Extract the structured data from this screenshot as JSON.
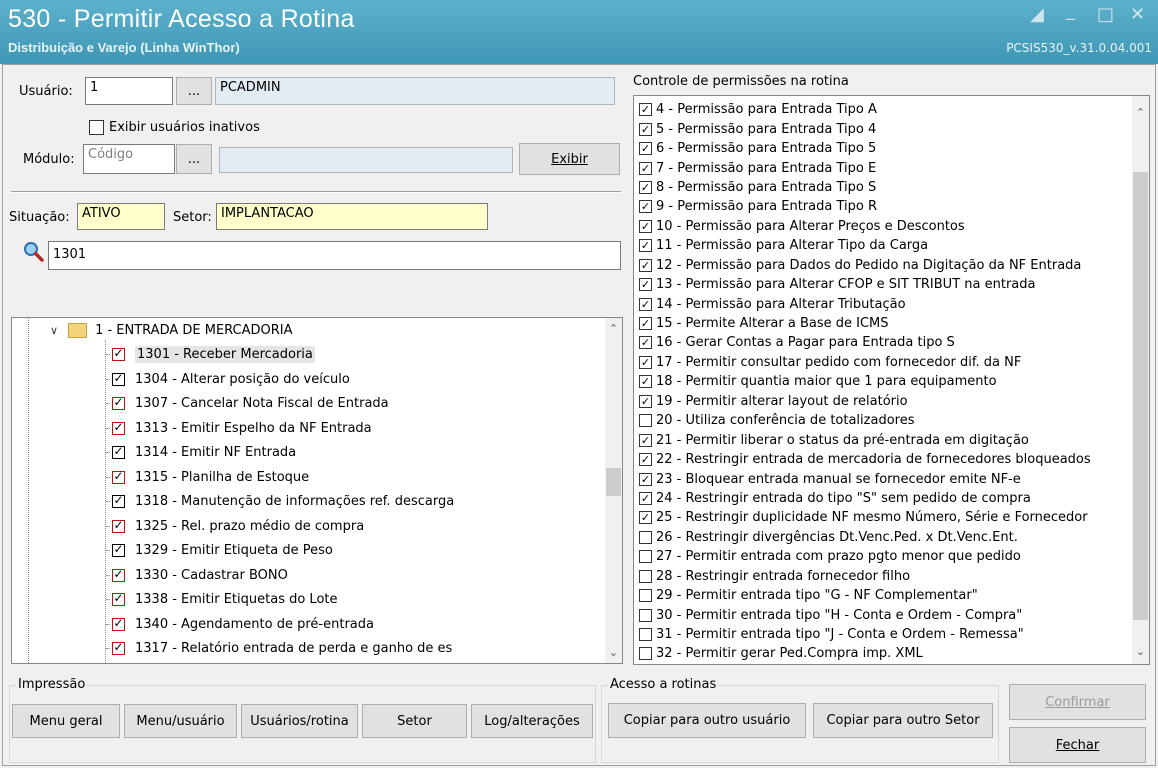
{
  "window": {
    "title": "530 - Permitir Acesso a Rotina",
    "subtitle": "Distribuição e Varejo (Linha WinThor)",
    "version": "PCSIS530_v.31.0.04.001"
  },
  "form": {
    "usuario_label": "Usuário:",
    "usuario_value": "1",
    "usuario_name": "PCADMIN",
    "browse_label": "...",
    "inativos_label": "Exibir usuários inativos",
    "modulo_label": "Módulo:",
    "modulo_placeholder": "Código",
    "modulo_name": "",
    "exibir_label": "Exibir",
    "situacao_label": "Situação:",
    "situacao_value": "ATIVO",
    "setor_label": "Setor:",
    "setor_value": "IMPLANTACAO",
    "search_value": "1301"
  },
  "tree": {
    "root_label": "1 - ENTRADA DE MERCADORIA",
    "items": [
      {
        "label": "1301 - Receber Mercadoria",
        "checked": true,
        "red": true,
        "selected": true
      },
      {
        "label": "1304 - Alterar posição do veículo",
        "checked": true,
        "red": false
      },
      {
        "label": "1307 - Cancelar Nota Fiscal de  Entrada",
        "checked": true,
        "red": true
      },
      {
        "label": "1313 - Emitir Espelho da NF Entrada",
        "checked": true,
        "red": true
      },
      {
        "label": "1314 - Emitir NF Entrada",
        "checked": true,
        "red": false
      },
      {
        "label": "1315 - Planilha de Estoque",
        "checked": true,
        "red": true
      },
      {
        "label": "1318 - Manutenção de informações ref. descarga",
        "checked": true,
        "red": false
      },
      {
        "label": "1325 - Rel. prazo médio de compra",
        "checked": true,
        "red": true
      },
      {
        "label": "1329 - Emitir Etiqueta de Peso",
        "checked": true,
        "red": false
      },
      {
        "label": "1330 - Cadastrar BONO",
        "checked": true,
        "red": true
      },
      {
        "label": "1338 - Emitir Etiquetas do Lote",
        "checked": true,
        "red": true
      },
      {
        "label": "1340 - Agendamento de pré-entrada",
        "checked": true,
        "red": true
      },
      {
        "label": "1317 - Relatório entrada de perda e ganho de es",
        "checked": true,
        "red": true
      }
    ]
  },
  "permissions": {
    "title": "Controle de permissões na rotina",
    "items": [
      {
        "label": "4 - Permissão para Entrada Tipo A",
        "checked": true
      },
      {
        "label": "5 - Permissão para Entrada Tipo 4",
        "checked": true
      },
      {
        "label": "6 - Permissão para Entrada Tipo 5",
        "checked": true
      },
      {
        "label": "7 - Permissão para Entrada Tipo E",
        "checked": true
      },
      {
        "label": "8 - Permissão para Entrada Tipo S",
        "checked": true
      },
      {
        "label": "9 - Permissão para Entrada Tipo R",
        "checked": true
      },
      {
        "label": "10 - Permissão para Alterar Preços e Descontos",
        "checked": true
      },
      {
        "label": "11 - Permissão para Alterar Tipo da Carga",
        "checked": true
      },
      {
        "label": "12 - Permissão para Dados do Pedido na Digitação da NF Entrada",
        "checked": true
      },
      {
        "label": "13 - Permissão para Alterar CFOP e SIT TRIBUT na entrada",
        "checked": true
      },
      {
        "label": "14 - Permissão para Alterar Tributação",
        "checked": true
      },
      {
        "label": "15 - Permite Alterar a Base de ICMS",
        "checked": true
      },
      {
        "label": "16 - Gerar Contas a Pagar para Entrada tipo S",
        "checked": true
      },
      {
        "label": "17 - Permitir consultar pedido com fornecedor dif. da NF",
        "checked": true
      },
      {
        "label": "18 - Permitir quantia maior que 1 para equipamento",
        "checked": true
      },
      {
        "label": "19 - Permitir alterar layout de relatório",
        "checked": true
      },
      {
        "label": "20 - Utiliza conferência de totalizadores",
        "checked": false
      },
      {
        "label": "21 - Permitir liberar o status da pré-entrada em digitação",
        "checked": true
      },
      {
        "label": "22 - Restringir entrada de mercadoria de fornecedores bloqueados",
        "checked": true
      },
      {
        "label": "23 - Bloquear entrada manual se fornecedor emite NF-e",
        "checked": true
      },
      {
        "label": "24 - Restringir entrada do tipo \"S\" sem pedido de compra",
        "checked": true
      },
      {
        "label": "25 - Restringir duplicidade NF mesmo Número, Série e Fornecedor",
        "checked": true
      },
      {
        "label": "26 - Restringir divergências Dt.Venc.Ped. x Dt.Venc.Ent.",
        "checked": false
      },
      {
        "label": "27 - Permitir entrada com prazo pgto menor que pedido",
        "checked": false
      },
      {
        "label": "28 - Restringir entrada fornecedor filho",
        "checked": false
      },
      {
        "label": "29 - Permitir entrada tipo \"G - NF Complementar\"",
        "checked": false
      },
      {
        "label": "30 - Permitir entrada tipo \"H - Conta e Ordem - Compra\"",
        "checked": false
      },
      {
        "label": "31 - Permitir entrada tipo \"J - Conta e Ordem - Remessa\"",
        "checked": false
      },
      {
        "label": "32 - Permitir gerar Ped.Compra imp. XML",
        "checked": false
      }
    ]
  },
  "impressao": {
    "title": "Impressão",
    "menu_geral": "Menu geral",
    "menu_usuario": "Menu/usuário",
    "usuarios_rotina": "Usuários/rotina",
    "setor": "Setor",
    "log": "Log/alterações"
  },
  "acesso": {
    "title": "Acesso a rotinas",
    "copiar_usuario": "Copiar para outro usuário",
    "copiar_setor": "Copiar para outro Setor"
  },
  "actions": {
    "confirmar": "Confirmar",
    "fechar": "Fechar"
  }
}
